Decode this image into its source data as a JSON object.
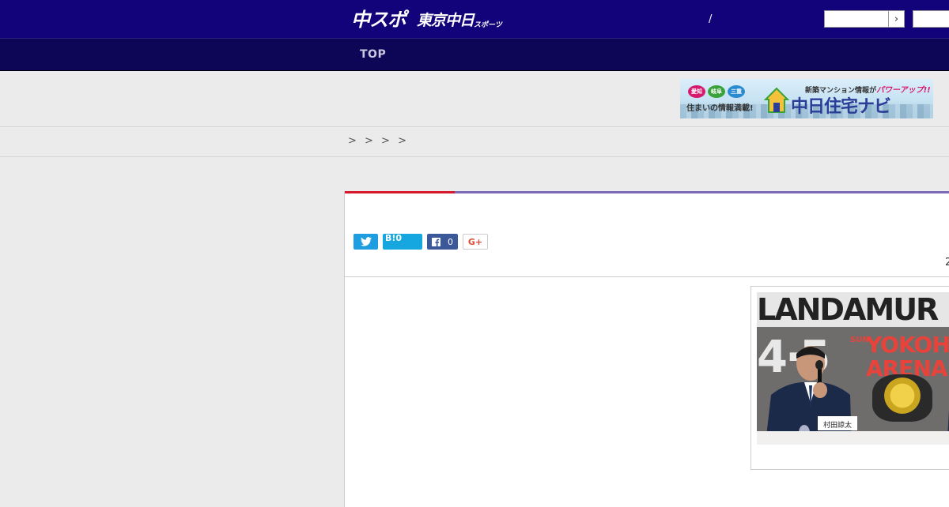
{
  "header": {
    "logo_main": "中スポ",
    "logo_sub": "東京中日",
    "logo_tiny": "スポーツ",
    "slash": "/",
    "search": {
      "placeholder": "",
      "button_glyph": "›"
    }
  },
  "nav": {
    "top_label": "TOP"
  },
  "ad": {
    "badges": [
      "愛知",
      "岐阜",
      "三重"
    ],
    "badge_colors": [
      "#d6196d",
      "#3aa23a",
      "#2a8bd1"
    ],
    "text_line1": "住まいの情報満載!",
    "text_line2_prefix": "新築マンション情報が",
    "text_line2_emph": "パワーアップ!!",
    "brand": "中日住宅ナビ"
  },
  "breadcrumb": {
    "text": "> > > >"
  },
  "share": {
    "hatena_label": "B!0",
    "facebook_count": "0",
    "google_label": "G+"
  },
  "article": {
    "date_fragment": "2"
  },
  "photo": {
    "banner_text": "LANDAMUR",
    "big_text": "4·5",
    "red_line1": "YOKOHA",
    "red_line2": "ARENA",
    "red_vertical": "SUN",
    "nameplate": "村田諒太"
  },
  "colors": {
    "header_bg": "#13037a",
    "nav_bg": "#0d0657",
    "rule_red": "#d61a2b",
    "rule_purple": "#7c6ab8",
    "twitter": "#1e9ee0",
    "hatena": "#16a7e0",
    "facebook": "#3b5998",
    "google": "#dd4b39"
  }
}
